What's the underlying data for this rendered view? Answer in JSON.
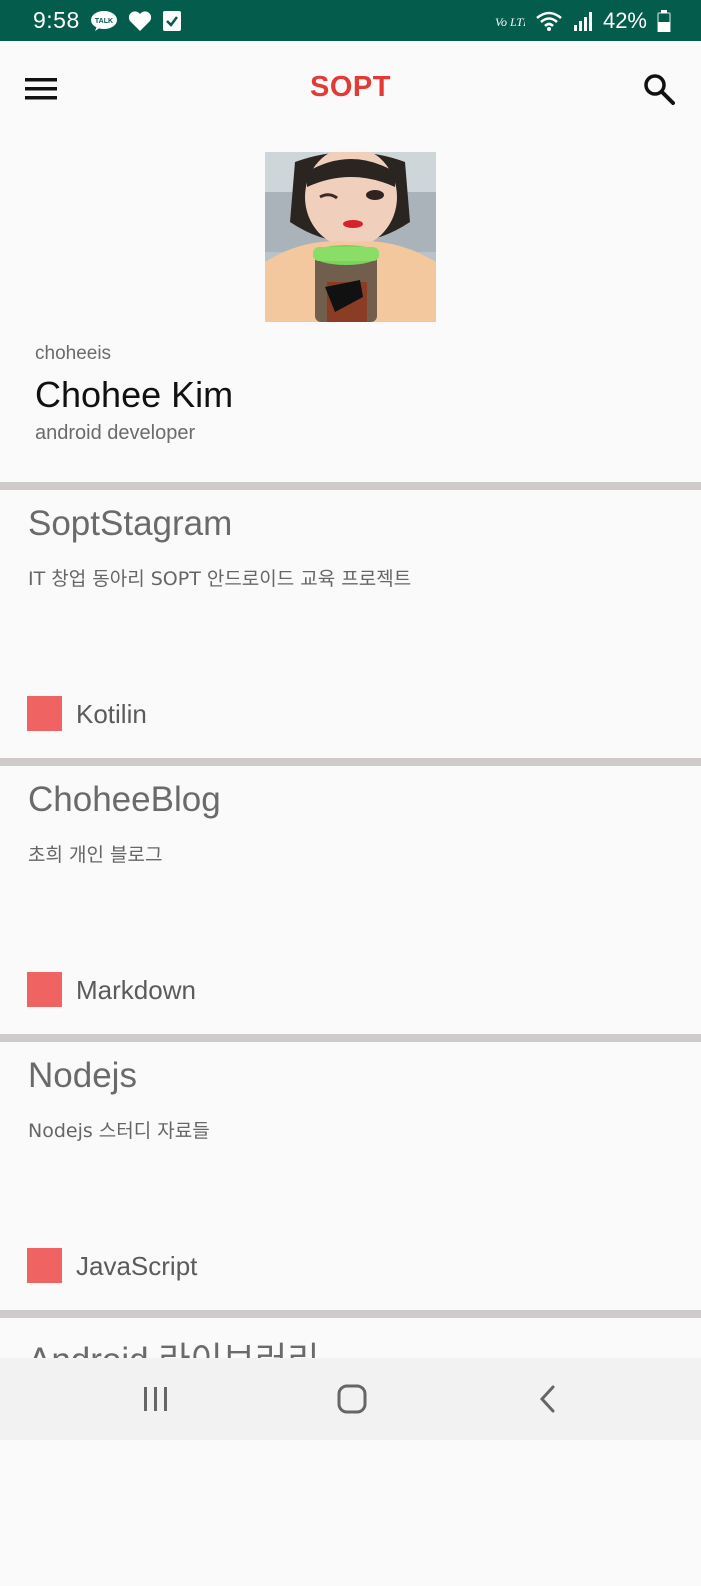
{
  "status_bar": {
    "time": "9:58",
    "battery": "42%",
    "left_icons": [
      "kakaotalk-icon",
      "heart-icon",
      "checkbox-icon"
    ],
    "right_icons": [
      "volte-icon",
      "wifi-icon",
      "signal-icon",
      "battery-icon"
    ],
    "volte_label": "Vo LTE",
    "talk_label": "TALK",
    "background": "#035c4c"
  },
  "app_bar": {
    "title": "SOPT",
    "title_color": "#e53935",
    "menu_icon": "menu-icon",
    "search_icon": "search-icon"
  },
  "profile": {
    "username": "choheeis",
    "full_name": "Chohee Kim",
    "bio": "android developer"
  },
  "repos": [
    {
      "name": "SoptStagram",
      "description": "IT 창업 동아리 SOPT 안드로이드 교육 프로젝트",
      "language": "Kotilin",
      "language_color": "#ef6363"
    },
    {
      "name": "ChoheeBlog",
      "description": "초희 개인 블로그",
      "language": "Markdown",
      "language_color": "#ef6363"
    },
    {
      "name": "Nodejs",
      "description": "Nodejs 스터디 자료들",
      "language": "JavaScript",
      "language_color": "#ef6363"
    },
    {
      "name": "Android 라이브러리",
      "description": "",
      "language": "",
      "language_color": "#ef6363"
    }
  ],
  "nav_bar": {
    "buttons": [
      "recent-apps-icon",
      "home-icon",
      "back-icon"
    ]
  }
}
